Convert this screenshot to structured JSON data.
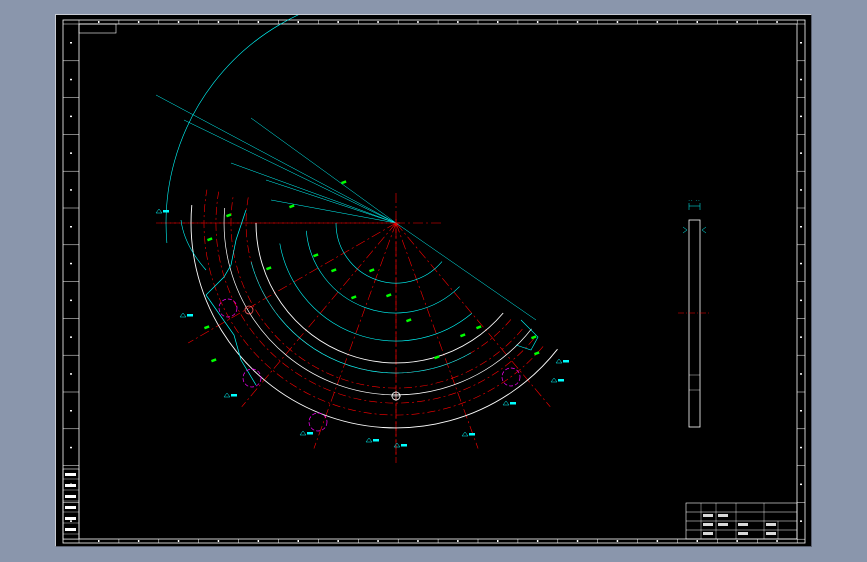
{
  "colors": {
    "background": "#000000",
    "frame": "#ffffff",
    "centerline": "#ff0000",
    "dimension": "#00ffff",
    "dim_text": "#00ff00",
    "weld_marker": "#ff00ff",
    "part_outline": "#ffffff"
  },
  "drawing": {
    "dim_labels": [
      "",
      "",
      "",
      "",
      "",
      "",
      "",
      "",
      ""
    ],
    "weld_labels": [
      "",
      "",
      "",
      "",
      "",
      "",
      "",
      "",
      "",
      ""
    ],
    "section_labels": [
      "",
      ""
    ]
  },
  "title_block": {
    "rows": [
      "",
      "",
      "",
      ""
    ]
  },
  "left_block": {
    "rows": [
      "",
      "",
      "",
      "",
      "",
      ""
    ]
  }
}
